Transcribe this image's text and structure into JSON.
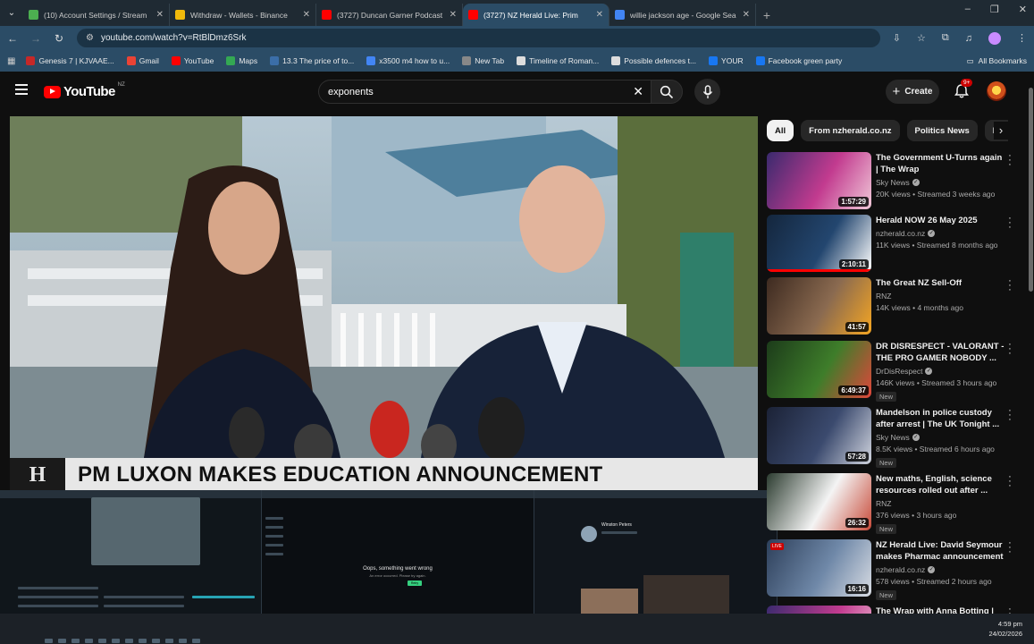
{
  "browser": {
    "tabs": [
      {
        "title": "(10) Account Settings / Stream",
        "favicon_color": "#4caf50"
      },
      {
        "title": "Withdraw - Wallets - Binance",
        "favicon_color": "#f0b90b"
      },
      {
        "title": "(3727) Duncan Garner Podcast",
        "favicon_color": "#ff0000"
      },
      {
        "title": "(3727) NZ Herald Live: Prim",
        "favicon_color": "#ff0000",
        "active": true
      },
      {
        "title": "willie jackson age - Google Sea",
        "favicon_color": "#4285f4"
      }
    ],
    "url": "youtube.com/watch?v=RtBlDmz6Srk",
    "bookmarks": [
      {
        "label": "Genesis 7 | KJVAAE...",
        "color": "#c62828"
      },
      {
        "label": "Gmail",
        "color": "#ea4335"
      },
      {
        "label": "YouTube",
        "color": "#ff0000"
      },
      {
        "label": "Maps",
        "color": "#34a853"
      },
      {
        "label": "13.3 The price of to...",
        "color": "#3b6ea8"
      },
      {
        "label": "x3500 m4 how to u...",
        "color": "#4285f4"
      },
      {
        "label": "New Tab",
        "color": "#888888"
      },
      {
        "label": "Timeline of Roman...",
        "color": "#dddddd"
      },
      {
        "label": "Possible defences t...",
        "color": "#dddddd"
      },
      {
        "label": "YOUR",
        "color": "#1877f2"
      },
      {
        "label": "Facebook green party",
        "color": "#1877f2"
      }
    ],
    "all_bookmarks": "All Bookmarks"
  },
  "youtube": {
    "logo": "YouTube",
    "country": "NZ",
    "search_value": "exponents",
    "create_label": "Create",
    "notifications": "9+"
  },
  "player": {
    "logo_text": "H",
    "headline": "PM LUXON MAKES EDUCATION ANNOUNCEMENT"
  },
  "previews": {
    "error_title": "Oops, something went wrong",
    "error_sub": "An error occurred. Please try again.",
    "error_button": "Retry",
    "profile_name": "Winston Peters"
  },
  "chips": [
    "All",
    "From nzherald.co.nz",
    "Politics News",
    "Related"
  ],
  "recommendations": [
    {
      "title": "The Government U-Turns again | The Wrap",
      "channel": "Sky News",
      "verified": true,
      "meta": "20K views • Streamed 3 weeks ago",
      "duration": "1:57:29",
      "new": false,
      "thumb": [
        "#3a2a6e",
        "#c23b8f",
        "#f0c8d8"
      ],
      "progress": 0,
      "badge": "sky news"
    },
    {
      "title": "Herald NOW 26 May 2025",
      "channel": "nzherald.co.nz",
      "verified": true,
      "meta": "11K views • Streamed 8 months ago",
      "duration": "2:10:11",
      "new": false,
      "thumb": [
        "#14263d",
        "#23466f",
        "#ffffff"
      ],
      "progress": 1,
      "badge": ""
    },
    {
      "title": "The Great NZ Sell-Off",
      "channel": "RNZ",
      "verified": false,
      "meta": "14K views • 4 months ago",
      "duration": "41:57",
      "new": false,
      "thumb": [
        "#3d2a20",
        "#8a6a50",
        "#f5a623"
      ],
      "progress": 0,
      "badge": "context"
    },
    {
      "title": "DR DISRESPECT - VALORANT - THE PRO GAMER NOBODY ...",
      "channel": "DrDisRespect",
      "verified": true,
      "meta": "146K views • Streamed 3 hours ago",
      "duration": "6:49:37",
      "new": true,
      "thumb": [
        "#1c3b1a",
        "#3e7d2a",
        "#e0463b"
      ],
      "progress": 0,
      "badge": ""
    },
    {
      "title": "Mandelson in police custody after arrest | The UK Tonight ...",
      "channel": "Sky News",
      "verified": true,
      "meta": "8.5K views • Streamed 6 hours ago",
      "duration": "57:28",
      "new": true,
      "thumb": [
        "#1b2236",
        "#3b4a6e",
        "#d0d4de"
      ],
      "progress": 0,
      "badge": "sky news"
    },
    {
      "title": "New maths, English, science resources rolled out after ...",
      "channel": "RNZ",
      "verified": false,
      "meta": "376 views • 3 hours ago",
      "duration": "26:32",
      "new": true,
      "thumb": [
        "#2c3c30",
        "#f4f4f4",
        "#c84b3a"
      ],
      "progress": 0,
      "badge": ""
    },
    {
      "title": "NZ Herald Live: David Seymour makes Pharmac announcement",
      "channel": "nzherald.co.nz",
      "verified": true,
      "meta": "578 views • Streamed 2 hours ago",
      "duration": "16:16",
      "new": true,
      "thumb": [
        "#2d3f5a",
        "#6f88a8",
        "#d9dde4"
      ],
      "progress": 0,
      "badge": "LIVE"
    },
    {
      "title": "The Wrap with Anna Botting |",
      "channel": "",
      "verified": false,
      "meta": "",
      "duration": "",
      "new": false,
      "thumb": [
        "#3a2a6e",
        "#c23b8f",
        "#f0c8d8"
      ],
      "progress": 0,
      "badge": ""
    }
  ],
  "system": {
    "time": "4:59 pm",
    "date": "24/02/2026"
  }
}
